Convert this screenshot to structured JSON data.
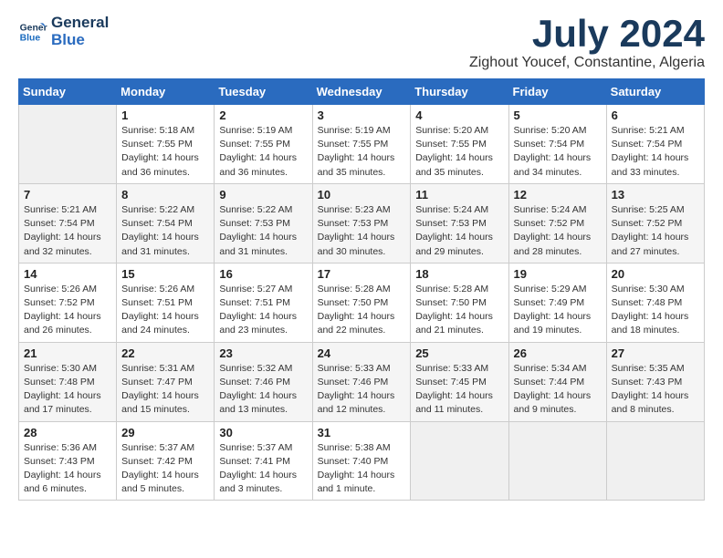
{
  "logo": {
    "line1": "General",
    "line2": "Blue"
  },
  "title": "July 2024",
  "subtitle": "Zighout Youcef, Constantine, Algeria",
  "weekdays": [
    "Sunday",
    "Monday",
    "Tuesday",
    "Wednesday",
    "Thursday",
    "Friday",
    "Saturday"
  ],
  "weeks": [
    [
      {
        "day": "",
        "info": ""
      },
      {
        "day": "1",
        "info": "Sunrise: 5:18 AM\nSunset: 7:55 PM\nDaylight: 14 hours\nand 36 minutes."
      },
      {
        "day": "2",
        "info": "Sunrise: 5:19 AM\nSunset: 7:55 PM\nDaylight: 14 hours\nand 36 minutes."
      },
      {
        "day": "3",
        "info": "Sunrise: 5:19 AM\nSunset: 7:55 PM\nDaylight: 14 hours\nand 35 minutes."
      },
      {
        "day": "4",
        "info": "Sunrise: 5:20 AM\nSunset: 7:55 PM\nDaylight: 14 hours\nand 35 minutes."
      },
      {
        "day": "5",
        "info": "Sunrise: 5:20 AM\nSunset: 7:54 PM\nDaylight: 14 hours\nand 34 minutes."
      },
      {
        "day": "6",
        "info": "Sunrise: 5:21 AM\nSunset: 7:54 PM\nDaylight: 14 hours\nand 33 minutes."
      }
    ],
    [
      {
        "day": "7",
        "info": "Sunrise: 5:21 AM\nSunset: 7:54 PM\nDaylight: 14 hours\nand 32 minutes."
      },
      {
        "day": "8",
        "info": "Sunrise: 5:22 AM\nSunset: 7:54 PM\nDaylight: 14 hours\nand 31 minutes."
      },
      {
        "day": "9",
        "info": "Sunrise: 5:22 AM\nSunset: 7:53 PM\nDaylight: 14 hours\nand 31 minutes."
      },
      {
        "day": "10",
        "info": "Sunrise: 5:23 AM\nSunset: 7:53 PM\nDaylight: 14 hours\nand 30 minutes."
      },
      {
        "day": "11",
        "info": "Sunrise: 5:24 AM\nSunset: 7:53 PM\nDaylight: 14 hours\nand 29 minutes."
      },
      {
        "day": "12",
        "info": "Sunrise: 5:24 AM\nSunset: 7:52 PM\nDaylight: 14 hours\nand 28 minutes."
      },
      {
        "day": "13",
        "info": "Sunrise: 5:25 AM\nSunset: 7:52 PM\nDaylight: 14 hours\nand 27 minutes."
      }
    ],
    [
      {
        "day": "14",
        "info": "Sunrise: 5:26 AM\nSunset: 7:52 PM\nDaylight: 14 hours\nand 26 minutes."
      },
      {
        "day": "15",
        "info": "Sunrise: 5:26 AM\nSunset: 7:51 PM\nDaylight: 14 hours\nand 24 minutes."
      },
      {
        "day": "16",
        "info": "Sunrise: 5:27 AM\nSunset: 7:51 PM\nDaylight: 14 hours\nand 23 minutes."
      },
      {
        "day": "17",
        "info": "Sunrise: 5:28 AM\nSunset: 7:50 PM\nDaylight: 14 hours\nand 22 minutes."
      },
      {
        "day": "18",
        "info": "Sunrise: 5:28 AM\nSunset: 7:50 PM\nDaylight: 14 hours\nand 21 minutes."
      },
      {
        "day": "19",
        "info": "Sunrise: 5:29 AM\nSunset: 7:49 PM\nDaylight: 14 hours\nand 19 minutes."
      },
      {
        "day": "20",
        "info": "Sunrise: 5:30 AM\nSunset: 7:48 PM\nDaylight: 14 hours\nand 18 minutes."
      }
    ],
    [
      {
        "day": "21",
        "info": "Sunrise: 5:30 AM\nSunset: 7:48 PM\nDaylight: 14 hours\nand 17 minutes."
      },
      {
        "day": "22",
        "info": "Sunrise: 5:31 AM\nSunset: 7:47 PM\nDaylight: 14 hours\nand 15 minutes."
      },
      {
        "day": "23",
        "info": "Sunrise: 5:32 AM\nSunset: 7:46 PM\nDaylight: 14 hours\nand 13 minutes."
      },
      {
        "day": "24",
        "info": "Sunrise: 5:33 AM\nSunset: 7:46 PM\nDaylight: 14 hours\nand 12 minutes."
      },
      {
        "day": "25",
        "info": "Sunrise: 5:33 AM\nSunset: 7:45 PM\nDaylight: 14 hours\nand 11 minutes."
      },
      {
        "day": "26",
        "info": "Sunrise: 5:34 AM\nSunset: 7:44 PM\nDaylight: 14 hours\nand 9 minutes."
      },
      {
        "day": "27",
        "info": "Sunrise: 5:35 AM\nSunset: 7:43 PM\nDaylight: 14 hours\nand 8 minutes."
      }
    ],
    [
      {
        "day": "28",
        "info": "Sunrise: 5:36 AM\nSunset: 7:43 PM\nDaylight: 14 hours\nand 6 minutes."
      },
      {
        "day": "29",
        "info": "Sunrise: 5:37 AM\nSunset: 7:42 PM\nDaylight: 14 hours\nand 5 minutes."
      },
      {
        "day": "30",
        "info": "Sunrise: 5:37 AM\nSunset: 7:41 PM\nDaylight: 14 hours\nand 3 minutes."
      },
      {
        "day": "31",
        "info": "Sunrise: 5:38 AM\nSunset: 7:40 PM\nDaylight: 14 hours\nand 1 minute."
      },
      {
        "day": "",
        "info": ""
      },
      {
        "day": "",
        "info": ""
      },
      {
        "day": "",
        "info": ""
      }
    ]
  ]
}
